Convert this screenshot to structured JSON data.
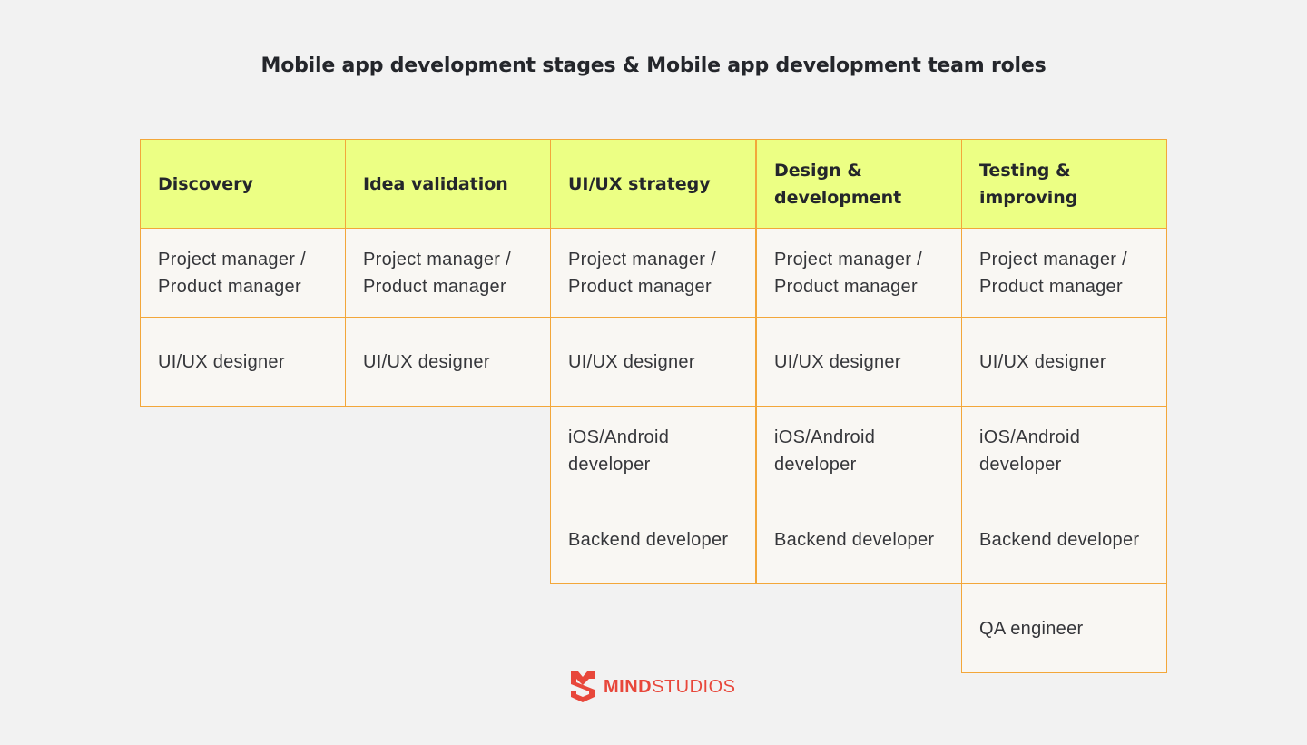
{
  "title": "Mobile app development stages & Mobile app development team roles",
  "stages": [
    {
      "label": "Discovery",
      "roles": [
        "Project manager / Product manager",
        "UI/UX designer"
      ]
    },
    {
      "label": "Idea validation",
      "roles": [
        "Project manager / Product manager",
        "UI/UX designer"
      ]
    },
    {
      "label": "UI/UX strategy",
      "roles": [
        "Project manager / Product manager",
        "UI/UX designer",
        "iOS/Android developer",
        "Backend developer"
      ]
    },
    {
      "label": "Design & development",
      "roles": [
        "Project manager / Product manager",
        "UI/UX designer",
        "iOS/Android developer",
        "Backend developer"
      ]
    },
    {
      "label": "Testing & improving",
      "roles": [
        "Project manager / Product manager",
        "UI/UX designer",
        "iOS/Android developer",
        "Backend developer",
        "QA engineer"
      ]
    }
  ],
  "logo": {
    "icon": "mindstudios-shield-icon",
    "text_bold": "MIND",
    "text_regular": "STUDIOS"
  },
  "colors": {
    "header_fill": "#ecff84",
    "cell_fill": "#f9f7f3",
    "border": "#f3a73a",
    "background": "#f2f2f2",
    "brand": "#e8473b"
  }
}
